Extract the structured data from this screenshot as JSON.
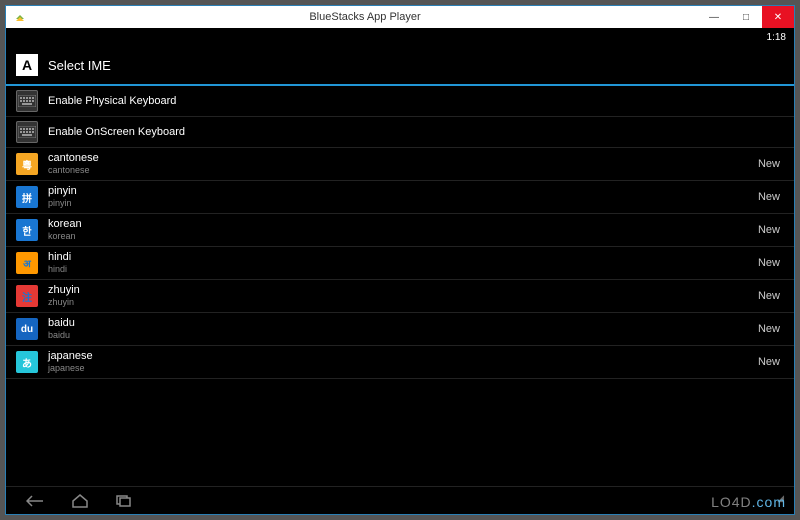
{
  "window": {
    "title": "BlueStacks App Player",
    "minimize": "—",
    "maximize": "□",
    "close": "✕"
  },
  "status": {
    "time": "1:18"
  },
  "header": {
    "icon_text": "A",
    "title": "Select IME"
  },
  "keyboard_items": [
    {
      "label": "Enable Physical Keyboard"
    },
    {
      "label": "Enable OnScreen Keyboard"
    }
  ],
  "ime_items": [
    {
      "label": "cantonese",
      "sublabel": "cantonese",
      "status": "New",
      "bg": "#f5a623",
      "fg": "#fff",
      "glyph": "粵"
    },
    {
      "label": "pinyin",
      "sublabel": "pinyin",
      "status": "New",
      "bg": "#1976d2",
      "fg": "#fff",
      "glyph": "拼"
    },
    {
      "label": "korean",
      "sublabel": "korean",
      "status": "New",
      "bg": "#1976d2",
      "fg": "#fff",
      "glyph": "한"
    },
    {
      "label": "hindi",
      "sublabel": "hindi",
      "status": "New",
      "bg": "#ff9800",
      "fg": "#1976d2",
      "glyph": "अ"
    },
    {
      "label": "zhuyin",
      "sublabel": "zhuyin",
      "status": "New",
      "bg": "#e53935",
      "fg": "#1976d2",
      "glyph": "注"
    },
    {
      "label": "baidu",
      "sublabel": "baidu",
      "status": "New",
      "bg": "#1565c0",
      "fg": "#fff",
      "glyph": "du"
    },
    {
      "label": "japanese",
      "sublabel": "japanese",
      "status": "New",
      "bg": "#26c6da",
      "fg": "#fff",
      "glyph": "あ"
    }
  ],
  "watermark": "LO4D",
  "watermark_suffix": ".com"
}
